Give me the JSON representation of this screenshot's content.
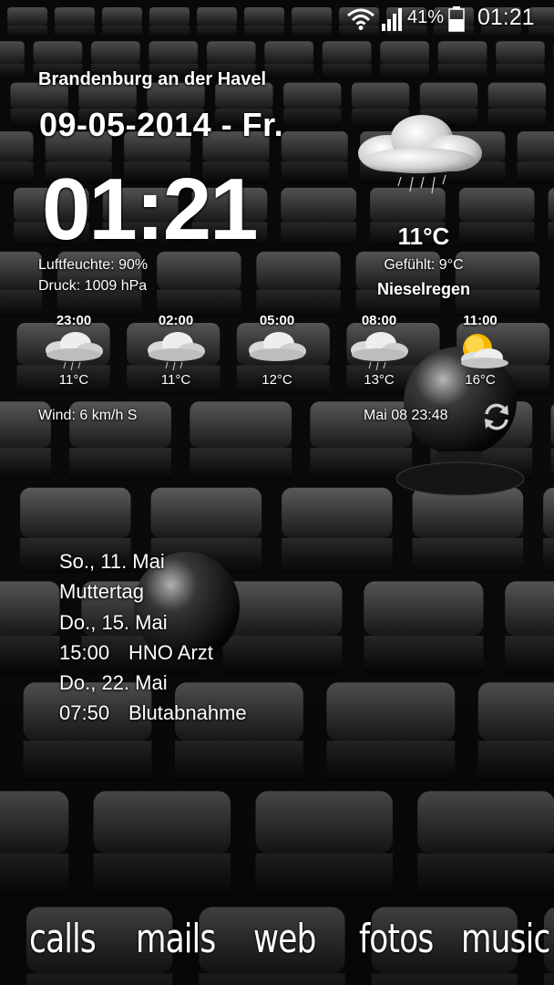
{
  "status_bar": {
    "battery_percent": "41%",
    "time": "01:21",
    "icons": [
      "wifi-icon",
      "signal-icon",
      "battery-icon"
    ]
  },
  "clock_widget": {
    "location": "Brandenburg an der Havel",
    "date": "09-05-2014 - Fr.",
    "time": "01:21",
    "humidity": "Luftfeuchte: 90%",
    "pressure": "Druck: 1009 hPa",
    "temperature": "11°C",
    "feels_like": "Gefühlt: 9°C",
    "condition": "Nieselregen",
    "condition_icon": "drizzle-cloud-icon",
    "wind": "Wind: 6 km/h S",
    "updated": "Mai 08  23:48",
    "forecast": [
      {
        "time": "23:00",
        "temp": "11°C",
        "icon": "drizzle-cloud-icon"
      },
      {
        "time": "02:00",
        "temp": "11°C",
        "icon": "drizzle-cloud-icon"
      },
      {
        "time": "05:00",
        "temp": "12°C",
        "icon": "cloud-icon"
      },
      {
        "time": "08:00",
        "temp": "13°C",
        "icon": "drizzle-cloud-icon"
      },
      {
        "time": "11:00",
        "temp": "16°C",
        "icon": "sun-cloud-icon"
      }
    ]
  },
  "agenda": [
    {
      "day": "So., 11. Mai",
      "events": [
        {
          "time": "",
          "title": "Muttertag"
        }
      ]
    },
    {
      "day": "Do., 15. Mai",
      "events": [
        {
          "time": "15:00",
          "title": "HNO Arzt"
        }
      ]
    },
    {
      "day": "Do., 22. Mai",
      "events": [
        {
          "time": "07:50",
          "title": "Blutabnahme"
        }
      ]
    }
  ],
  "dock": [
    "calls",
    "mails",
    "web",
    "fotos",
    "music"
  ],
  "colors": {
    "text": "#ffffff",
    "background": "#0b0b0b",
    "sun": "#f5b800"
  }
}
